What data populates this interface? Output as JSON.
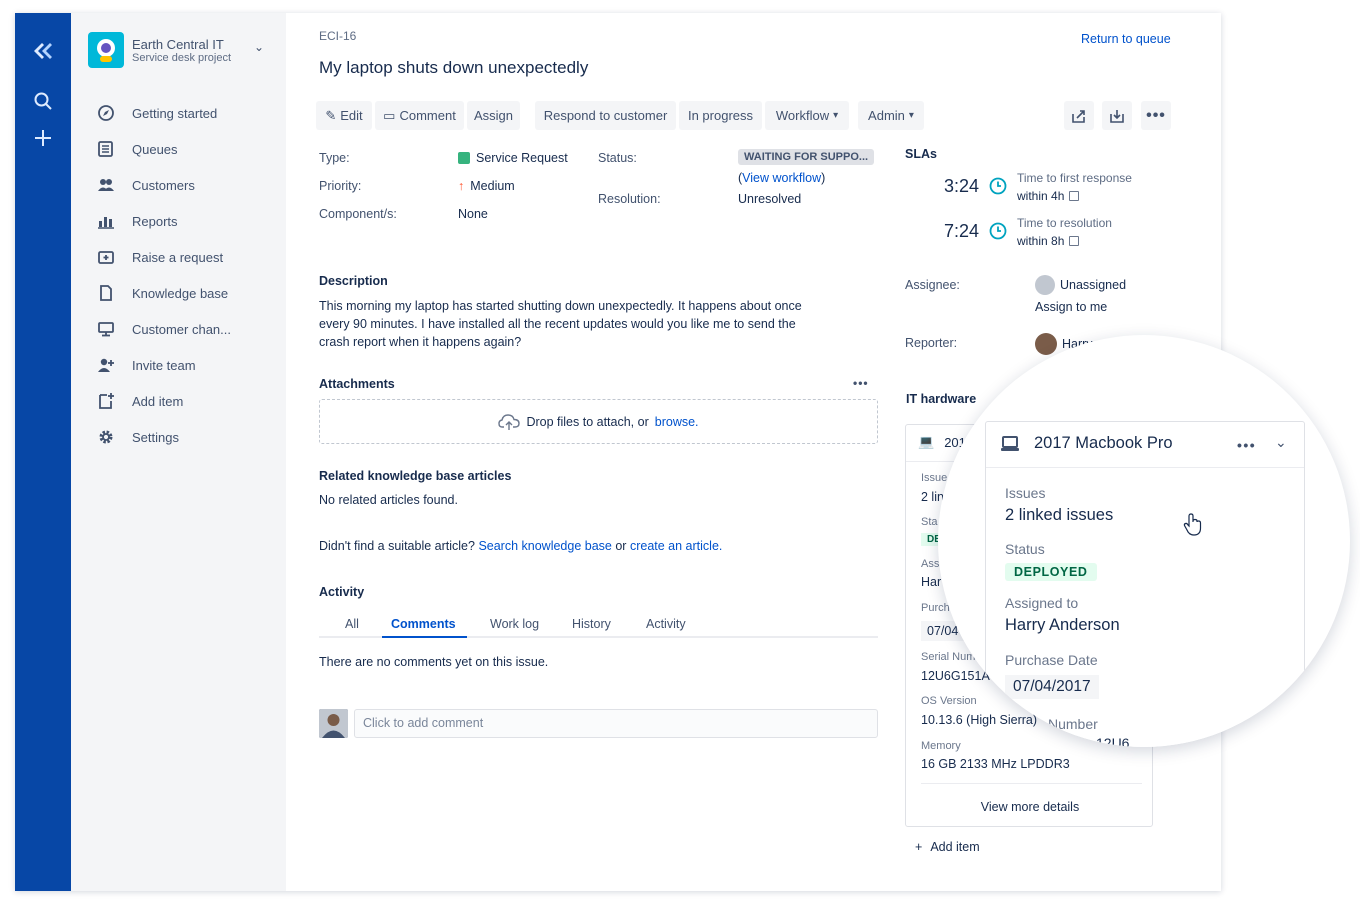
{
  "global_nav": {
    "icons": [
      "jira-logo-icon",
      "search-icon",
      "plus-icon"
    ]
  },
  "project": {
    "name": "Earth Central IT",
    "type": "Service desk project"
  },
  "sidebar": {
    "items": [
      {
        "label": "Getting started",
        "icon": "compass-icon"
      },
      {
        "label": "Queues",
        "icon": "queue-icon"
      },
      {
        "label": "Customers",
        "icon": "people-icon"
      },
      {
        "label": "Reports",
        "icon": "chart-icon"
      },
      {
        "label": "Raise a request",
        "icon": "add-request-icon"
      },
      {
        "label": "Knowledge base",
        "icon": "page-icon"
      },
      {
        "label": "Customer chan...",
        "icon": "monitor-icon"
      },
      {
        "label": "Invite team",
        "icon": "invite-icon"
      },
      {
        "label": "Add item",
        "icon": "add-item-icon"
      },
      {
        "label": "Settings",
        "icon": "gear-icon"
      }
    ]
  },
  "issue": {
    "key": "ECI-16",
    "return_label": "Return to queue",
    "title": "My laptop shuts down unexpectedly"
  },
  "toolbar": {
    "edit": "Edit",
    "comment": "Comment",
    "assign": "Assign",
    "respond": "Respond to customer",
    "in_progress": "In progress",
    "workflow": "Workflow",
    "admin": "Admin"
  },
  "details": {
    "type_label": "Type:",
    "type_value": "Service Request",
    "priority_label": "Priority:",
    "priority_value": "Medium",
    "component_label": "Component/s:",
    "component_value": "None",
    "status_label": "Status:",
    "status_value": "WAITING FOR SUPPO...",
    "view_workflow_open": "(",
    "view_workflow": "View workflow",
    "view_workflow_close": ")",
    "resolution_label": "Resolution:",
    "resolution_value": "Unresolved"
  },
  "description": {
    "heading": "Description",
    "line1": "This morning my laptop has started shutting down unexpectedly. It happens about once",
    "line2": "every 90 minutes. I have installed all the recent updates would you like me to send the",
    "line3": "crash report when it happens again?"
  },
  "attachments": {
    "heading": "Attachments",
    "drop_text": "Drop files to attach, or",
    "browse": "browse."
  },
  "kb": {
    "heading": "Related knowledge base articles",
    "none": "No related articles found.",
    "prompt": "Didn't find a suitable article?",
    "search": "Search knowledge base",
    "or": "or",
    "create": "create an article."
  },
  "activity": {
    "heading": "Activity",
    "tabs": [
      "All",
      "Comments",
      "Work log",
      "History",
      "Activity"
    ],
    "active_tab": "Comments",
    "empty": "There are no comments yet on this issue.",
    "comment_placeholder": "Click to add comment"
  },
  "slas": {
    "heading": "SLAs",
    "items": [
      {
        "time": "3:24",
        "title": "Time to first response",
        "target": "within 4h"
      },
      {
        "time": "7:24",
        "title": "Time to resolution",
        "target": "within 8h"
      }
    ]
  },
  "people": {
    "assignee_label": "Assignee:",
    "assignee_value": "Unassigned",
    "assign_to_me": "Assign to me",
    "reporter_label": "Reporter:",
    "reporter_value": "Harry"
  },
  "hardware": {
    "heading": "IT hardware",
    "card_title": "2017",
    "issues_label": "Issue",
    "issues_value": "2 lin",
    "status_label": "Sta",
    "status_value": "DE",
    "assigned_label": "Ass",
    "assigned_value": "Har",
    "purchase_label": "Purch",
    "purchase_value": "07/04",
    "serial_label": "Serial Num",
    "serial_value": "12U6G151A",
    "os_label": "OS Version",
    "os_value": "10.13.6 (High Sierra)",
    "memory_label": "Memory",
    "memory_value": "16 GB 2133 MHz LPDDR3",
    "view_more": "View more details",
    "add_item": "Add item"
  },
  "zoom": {
    "title": "2017 Macbook Pro",
    "issues_label": "Issues",
    "issues_value": "2 linked issues",
    "status_label": "Status",
    "status_value": "DEPLOYED",
    "assigned_label": "Assigned to",
    "assigned_value": "Harry Anderson",
    "purchase_label": "Purchase Date",
    "purchase_value": "07/04/2017",
    "serial_partial": "Number",
    "serial_value_partial": "12U6"
  },
  "colors": {
    "global_nav": "#0747a6",
    "link": "#0052cc",
    "deployed_bg": "#e3fcef",
    "deployed_text": "#006644",
    "sla_clock": "#00a3bf"
  }
}
